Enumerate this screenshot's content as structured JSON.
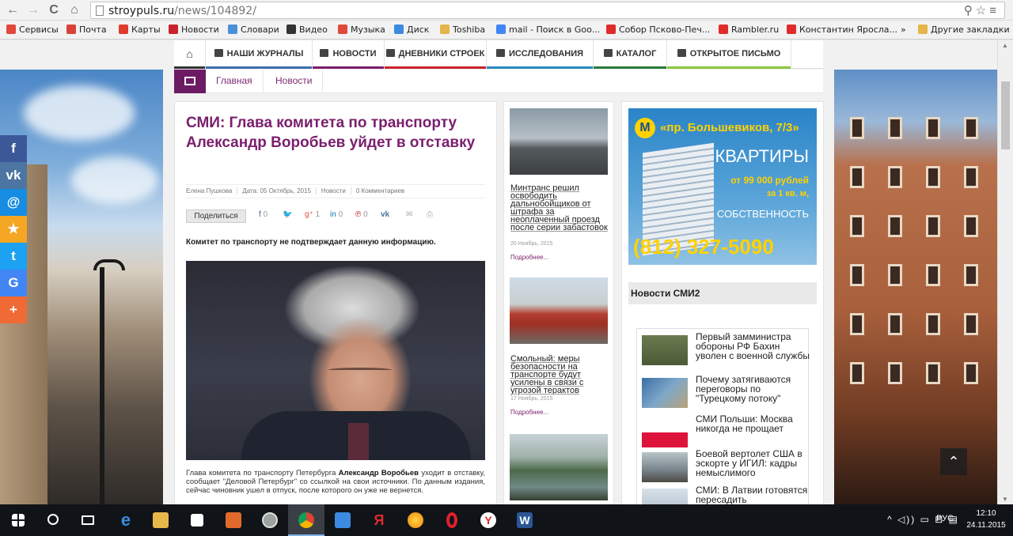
{
  "browser": {
    "url_host": "stroypuls.ru",
    "url_path": "/news/104892/",
    "bookmarks": [
      {
        "label": "Сервисы",
        "color": "#e0483c"
      },
      {
        "label": "Почта",
        "color": "#d9413a"
      },
      {
        "label": "Карты",
        "color": "#e03b2c"
      },
      {
        "label": "Новости",
        "color": "#c8232c"
      },
      {
        "label": "Словари",
        "color": "#4a90d9"
      },
      {
        "label": "Видео",
        "color": "#333333"
      },
      {
        "label": "Музыка",
        "color": "#e0483c"
      },
      {
        "label": "Диск",
        "color": "#3c8be0"
      },
      {
        "label": "Toshiba",
        "color": "#e3b54a"
      },
      {
        "label": "mail - Поиск в Goo...",
        "color": "#4285f4"
      },
      {
        "label": "Собор Псково-Печ...",
        "color": "#e02b2b"
      },
      {
        "label": "Rambler.ru",
        "color": "#e02b2b"
      },
      {
        "label": "Константин Яросла...",
        "color": "#e02b2b"
      },
      {
        "label": "»",
        "color": ""
      },
      {
        "label": "Другие закладки",
        "color": "#e3b54a"
      }
    ]
  },
  "topnav": [
    {
      "label": "",
      "icon": "home-icon",
      "color": "#333333"
    },
    {
      "label": "НАШИ ЖУРНАЛЫ",
      "icon": "book-icon",
      "color": "#3a6fb0"
    },
    {
      "label": "НОВОСТИ",
      "icon": "news-icon",
      "color": "#7a1e6d"
    },
    {
      "label": "ДНЕВНИКИ СТРОЕК",
      "icon": "crane-icon",
      "color": "#c8232c"
    },
    {
      "label": "ИССЛЕДОВАНИЯ",
      "icon": "chart-icon",
      "color": "#2b8bc0"
    },
    {
      "label": "КАТАЛОГ",
      "icon": "car-icon",
      "color": "#2b7a3d"
    },
    {
      "label": "ОТКРЫТОЕ ПИСЬМО",
      "icon": "letter-icon",
      "color": "#8cc63f"
    }
  ],
  "breadcrumbs": [
    "Главная",
    "Новости"
  ],
  "article": {
    "title": "СМИ: Глава комитета по транспорту Александр Воробьев уйдет в отставку",
    "author": "Елена Пушкова",
    "date": "Дата: 05 Октябрь, 2015",
    "section": "Новости",
    "comments": "0 Комментариев",
    "share_label": "Поделиться",
    "share_counts": {
      "facebook": "0",
      "gplus": "1",
      "linkedin": "0",
      "pinterest": "0"
    },
    "lead": "Комитет по транспорту не подтверждает данную информацию.",
    "body_before": "Глава комитета по транспорту Петербурга ",
    "body_bold": "Александр Воробьев",
    "body_after": " уходит в отставку, сообщает \"Деловой Петербург\" со ссылкой на свои источники. По данным издания, сейчас чиновник ушел в отпуск, после которого он уже не вернется."
  },
  "related": [
    {
      "title": "Минтранс решил освободить дальнобойщиков от штрафа за неоплаченный проезд после серии забастовок",
      "date": "20 Ноябрь, 2015",
      "more": "Подробнее..."
    },
    {
      "title": "Смольный: меры безопасности на транспорте будут усилены в связи с угрозой терактов",
      "date": "17 Ноябрь, 2015",
      "more": "Подробнее..."
    },
    {
      "title": "",
      "date": "",
      "more": ""
    }
  ],
  "ad": {
    "metro": "М",
    "address": "«пр. Большевиков, 7/3»",
    "headline": "КВАРТИРЫ",
    "price": "от 99 000 рублей",
    "per": "за 1 кв. м,",
    "ownership": "СОБСТВЕННОСТЬ",
    "phone": "(812) 327-5090"
  },
  "smi": {
    "heading": "Новости СМИ2",
    "items": [
      {
        "text": "Первый замминистра обороны РФ Бахин уволен с военной службы"
      },
      {
        "text": "Почему затягиваются переговоры по \"Турецкому потоку\""
      },
      {
        "text": "СМИ Польши: Москва никогда не прощает"
      },
      {
        "text": "Боевой вертолет США в эскорте у ИГИЛ: кадры немыслимого"
      },
      {
        "text": "СМИ: В Латвии готовятся пересадить"
      }
    ]
  },
  "social": [
    {
      "glyph": "f",
      "name": "facebook-icon",
      "color": "#3b5998"
    },
    {
      "glyph": "vk",
      "name": "vk-icon",
      "color": "#4c75a3"
    },
    {
      "glyph": "@",
      "name": "mail-ru-icon",
      "color": "#168de2"
    },
    {
      "glyph": "★",
      "name": "bookmark-star-icon",
      "color": "#f5a623"
    },
    {
      "glyph": "t",
      "name": "twitter-icon",
      "color": "#1da1f2"
    },
    {
      "glyph": "G",
      "name": "google-icon",
      "color": "#4285f4"
    },
    {
      "glyph": "+",
      "name": "more-share-icon",
      "color": "#f06a35"
    }
  ],
  "taskbar": {
    "lang": "РУС",
    "time": "12:10",
    "date": "24.11.2015"
  }
}
